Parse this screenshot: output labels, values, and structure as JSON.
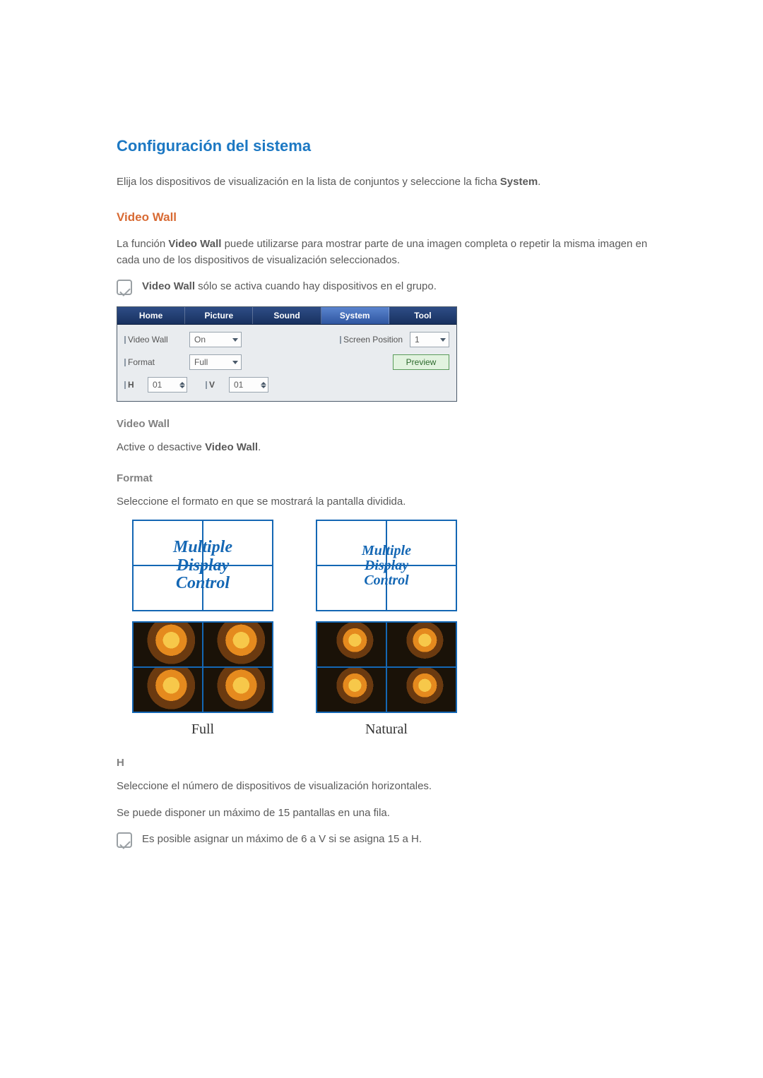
{
  "title": "Configuración del sistema",
  "intro_pre": "Elija los dispositivos de visualización en la lista de conjuntos y seleccione la ficha ",
  "intro_bold": "System",
  "intro_post": ".",
  "section_videowall": "Video Wall",
  "vw_para_pre": "La función ",
  "vw_para_bold": "Video Wall",
  "vw_para_post": " puede utilizarse para mostrar parte de una imagen completa o repetir la misma imagen en cada uno de los dispositivos de visualización seleccionados.",
  "vw_note_bold": "Video Wall",
  "vw_note_rest": " sólo se activa cuando hay dispositivos en el grupo.",
  "panel": {
    "tabs": [
      "Home",
      "Picture",
      "Sound",
      "System",
      "Tool"
    ],
    "active_tab_index": 3,
    "labels": {
      "video_wall": "Video Wall",
      "screen_position": "Screen Position",
      "format": "Format",
      "h": "H",
      "v": "V"
    },
    "values": {
      "video_wall": "On",
      "screen_position": "1",
      "format": "Full",
      "h": "01",
      "v": "01"
    },
    "preview_button": "Preview"
  },
  "sub_video_wall": "Video Wall",
  "sub_video_wall_text_pre": "Active o desactive ",
  "sub_video_wall_text_bold": "Video Wall",
  "sub_video_wall_text_post": ".",
  "sub_format": "Format",
  "sub_format_text": "Seleccione el formato en que se mostrará la pantalla dividida.",
  "mdc_lines": [
    "Multiple",
    "Display",
    "Control"
  ],
  "caption_full": "Full",
  "caption_natural": "Natural",
  "sub_h": "H",
  "h_text1": "Seleccione el número de dispositivos de visualización horizontales.",
  "h_text2": "Se puede disponer un máximo de 15 pantallas en una fila.",
  "h_note": "Es posible asignar un máximo de 6 a V si se asigna 15 a H."
}
